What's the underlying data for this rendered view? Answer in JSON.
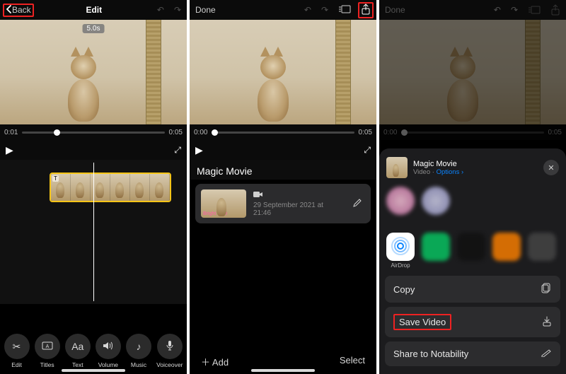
{
  "s1": {
    "back": "Back",
    "title": "Edit",
    "duration_bubble": "5.0s",
    "time_start": "0:01",
    "time_end": "0:05",
    "thumb_mark": "T",
    "tools": {
      "edit": "Edit",
      "titles": "Titles",
      "text": "Text",
      "volume": "Volume",
      "music": "Music",
      "voiceover": "Voiceover",
      "text_glyph": "Aa"
    }
  },
  "s2": {
    "done": "Done",
    "time_start": "0:00",
    "time_end": "0:05",
    "section": "Magic Movie",
    "clip_thumb_label": "Bright Side",
    "clip_date": "29 September 2021 at 21:46",
    "add": "Add",
    "select": "Select"
  },
  "s3": {
    "done": "Done",
    "time_start": "0:00",
    "time_end": "0:05",
    "sheet_title": "Magic Movie",
    "sheet_kind": "Video",
    "sheet_options": "Options",
    "apps": {
      "airdrop": "AirDrop"
    },
    "actions": {
      "copy": "Copy",
      "save": "Save Video",
      "share_nota": "Share to Notability"
    }
  }
}
